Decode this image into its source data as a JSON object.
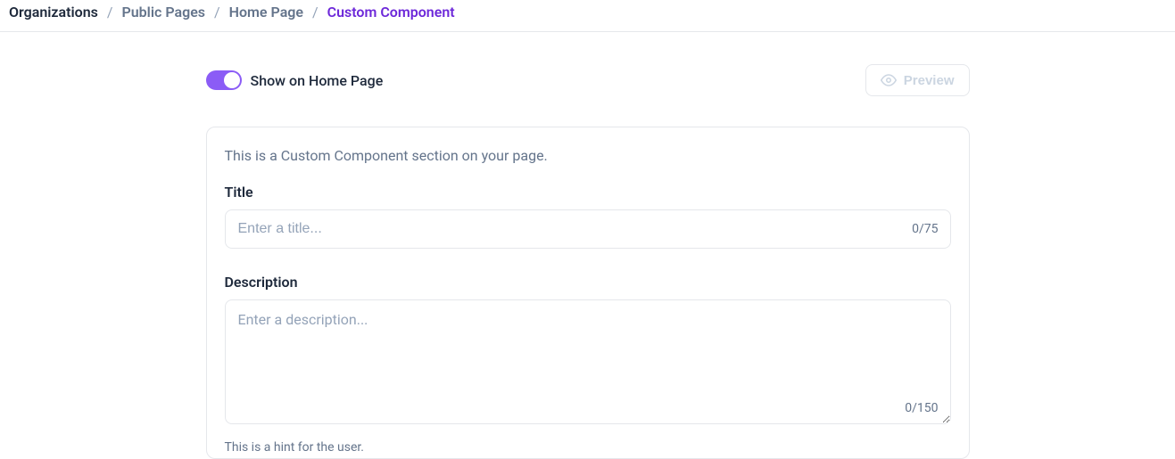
{
  "breadcrumb": {
    "items": [
      {
        "label": "Organizations",
        "active": false
      },
      {
        "label": "Public Pages",
        "active": false
      },
      {
        "label": "Home Page",
        "active": false
      },
      {
        "label": "Custom Component",
        "active": true
      }
    ]
  },
  "header": {
    "toggle": {
      "label": "Show on Home Page",
      "on": true
    },
    "preview_button": {
      "label": "Preview",
      "icon": "eye-icon"
    }
  },
  "card": {
    "intro": "This is a Custom Component section on your page.",
    "title": {
      "label": "Title",
      "placeholder": "Enter a title...",
      "value": "",
      "counter": "0/75",
      "max": 75
    },
    "description": {
      "label": "Description",
      "placeholder": "Enter a description...",
      "value": "",
      "counter": "0/150",
      "max": 150
    },
    "hint": "This is a hint for the user."
  },
  "colors": {
    "accent": "#8b5cf6",
    "text_primary": "#1e293b",
    "text_muted": "#64748b",
    "border": "#e5e7eb"
  }
}
